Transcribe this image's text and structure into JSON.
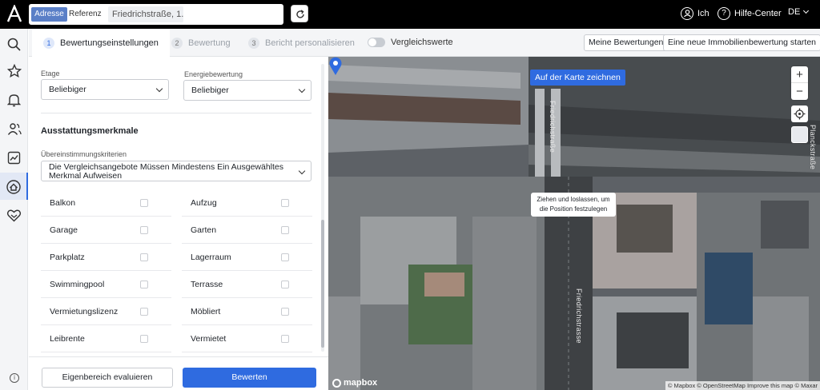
{
  "topbar": {
    "seg_active": "Adresse",
    "seg_other": "Referenz",
    "address_value": "Friedrichstraße, 1...",
    "user_label": "Ich",
    "help_label": "Hilfe-Center",
    "language": "DE"
  },
  "steps": [
    {
      "num": "1",
      "label": "Bewertungseinstellungen"
    },
    {
      "num": "2",
      "label": "Bewertung"
    },
    {
      "num": "3",
      "label": "Bericht personalisieren"
    }
  ],
  "toggle_label": "Vergleichswerte",
  "buttons": {
    "my_valuations": "Meine Bewertungen",
    "new_valuation": "Eine neue Immobilienbewertung starten",
    "evaluate_own": "Eigenbereich evaluieren",
    "evaluate": "Bewerten"
  },
  "form": {
    "floor_label": "Etage",
    "floor_value": "Beliebiger",
    "energy_label": "Energiebewertung",
    "energy_value": "Beliebiger",
    "section_title": "Ausstattungsmerkmale",
    "match_label": "Übereinstimmungskriterien",
    "match_value": "Die Vergleichsangebote Müssen Mindestens Ein Ausgewähltes Merkmal Aufweisen",
    "features_left": [
      "Balkon",
      "Garage",
      "Parkplatz",
      "Swimmingpool",
      "Vermietungslizenz",
      "Leibrente"
    ],
    "features_right": [
      "Aufzug",
      "Garten",
      "Lagerraum",
      "Terrasse",
      "Möbliert",
      "Vermietet"
    ]
  },
  "map": {
    "draw_button": "Auf der Karte zeichnen",
    "zoom_in": "+",
    "zoom_out": "−",
    "tooltip": "Ziehen und loslassen, um die Position festzulegen",
    "street_name": "Friedrichstrasse",
    "street_name_top": "Friedrichstraße",
    "street_name_right": "Planckstraße",
    "logo": "mapbox",
    "attribution": "© Mapbox © OpenStreetMap Improve this map © Maxar"
  },
  "colors": {
    "accent": "#2f6be0",
    "topbar": "#000000"
  }
}
